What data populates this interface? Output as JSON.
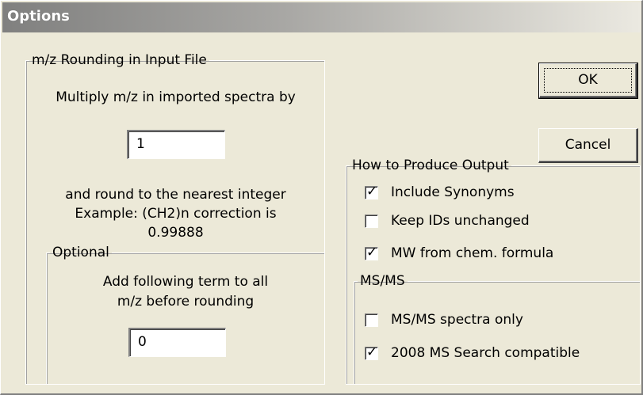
{
  "window": {
    "title": "Options"
  },
  "rounding": {
    "legend": "m/z Rounding in Input File",
    "multiply_label": "Multiply m/z in imported spectra by",
    "multiplier_value": "1",
    "round_note": "and round to the nearest integer",
    "example_line": "Example: (CH2)n correction is",
    "example_value": "0.99888"
  },
  "optional": {
    "legend": "Optional",
    "line1": "Add following term to all",
    "line2": "m/z before rounding",
    "term_value": "0"
  },
  "buttons": {
    "ok": "OK",
    "cancel": "Cancel"
  },
  "output": {
    "legend": "How to Produce Output",
    "include_synonyms": {
      "label": "Include Synonyms",
      "checked": true
    },
    "keep_ids": {
      "label": "Keep IDs unchanged",
      "checked": false
    },
    "mw_formula": {
      "label": "MW from chem. formula",
      "checked": true
    }
  },
  "msms": {
    "legend": "MS/MS",
    "spectra_only": {
      "label": "MS/MS spectra only",
      "checked": false
    },
    "ms_search_compat": {
      "label": "2008 MS Search compatible",
      "checked": true
    }
  }
}
